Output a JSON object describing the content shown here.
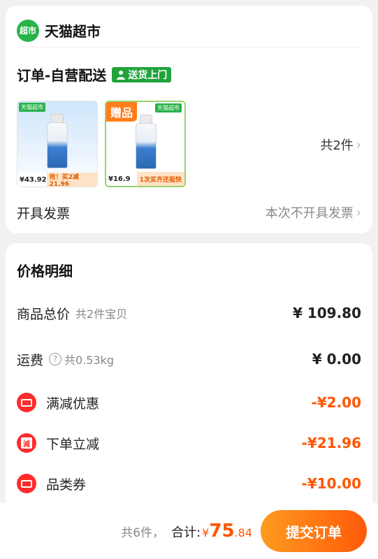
{
  "store": {
    "logo_text": "超市",
    "name": "天猫超市"
  },
  "order": {
    "type_label": "订单-自营配送",
    "delivery_badge": "送货上门",
    "products": [
      {
        "tag": "天猫超市",
        "price": "¥43.92",
        "promo": "抢！买2减21.96"
      },
      {
        "gift_label": "赠品",
        "tag": "天猫超市",
        "price": "¥16.9",
        "promo": "1次买齐还挺快"
      }
    ],
    "item_count": "共2件",
    "invoice": {
      "label": "开具发票",
      "value": "本次不开具发票"
    }
  },
  "price_detail": {
    "title": "价格明细",
    "rows": [
      {
        "label": "商品总价",
        "sub": "共2件宝贝",
        "amount": "¥ 109.80"
      },
      {
        "label": "运费",
        "sub": "共0.53kg",
        "amount": "¥ 0.00"
      },
      {
        "label": "满减优惠",
        "amount": "-¥2.00",
        "icon": "coupon-ticket-icon"
      },
      {
        "label": "下单立减",
        "amount": "-¥21.96",
        "icon": "instant-discount-icon",
        "icon_text": "減"
      },
      {
        "label": "品类券",
        "amount": "-¥10.00",
        "icon": "category-coupon-icon"
      }
    ]
  },
  "bottom_bar": {
    "item_count": "共6件，",
    "total_label": "合计:",
    "currency": "¥",
    "total_int": "75",
    "total_dec": ".84",
    "submit_label": "提交订单"
  },
  "colors": {
    "brand_green": "#2ab24a",
    "accent_orange": "#ff5500",
    "discount_red": "#ff2b2b"
  }
}
